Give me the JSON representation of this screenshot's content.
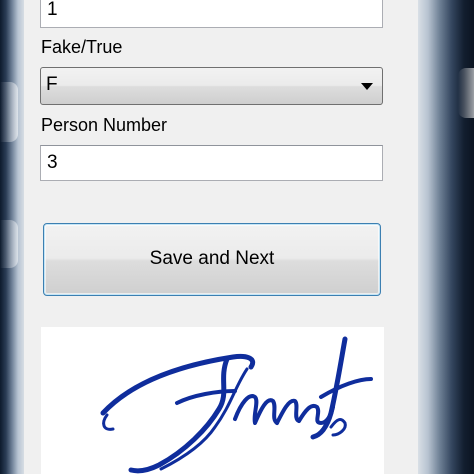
{
  "form": {
    "top_field_value": "1",
    "fake_true_label": "Fake/True",
    "fake_true_selected": "F",
    "person_number_label": "Person Number",
    "person_number_value": "3",
    "save_button_label": "Save and Next"
  },
  "colors": {
    "window_background": "#f0f0f0",
    "button_border_focus": "#3c7fb1",
    "signature_ink": "#0f2d9c"
  },
  "signature": {
    "icon": "handwritten-signature"
  }
}
